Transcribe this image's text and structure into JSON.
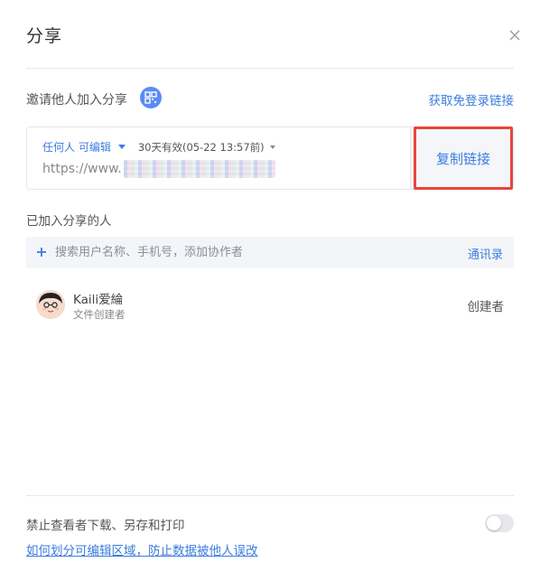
{
  "dialog": {
    "title": "分享"
  },
  "invite": {
    "label": "邀请他人加入分享",
    "free_login_link": "获取免登录链接"
  },
  "link": {
    "permission": "任何人 可编辑",
    "validity": "30天有效(05-22 13:57前)",
    "url_prefix": "https://www.",
    "copy_label": "复制链接"
  },
  "members": {
    "section_label": "已加入分享的人",
    "search_placeholder": "搜索用户名称、手机号，添加协作者",
    "contacts_label": "通讯录",
    "list": [
      {
        "name": "Kaili爱綸",
        "subtitle": "文件创建者",
        "role": "创建者"
      }
    ]
  },
  "footer": {
    "forbid_label": "禁止查看者下载、另存和打印",
    "forbid_enabled": false,
    "help_link": "如何划分可编辑区域，防止数据被他人误改"
  },
  "colors": {
    "accent": "#3b7dde",
    "highlight_border": "#e8453c",
    "qr_badge": "#5b8cf2"
  }
}
